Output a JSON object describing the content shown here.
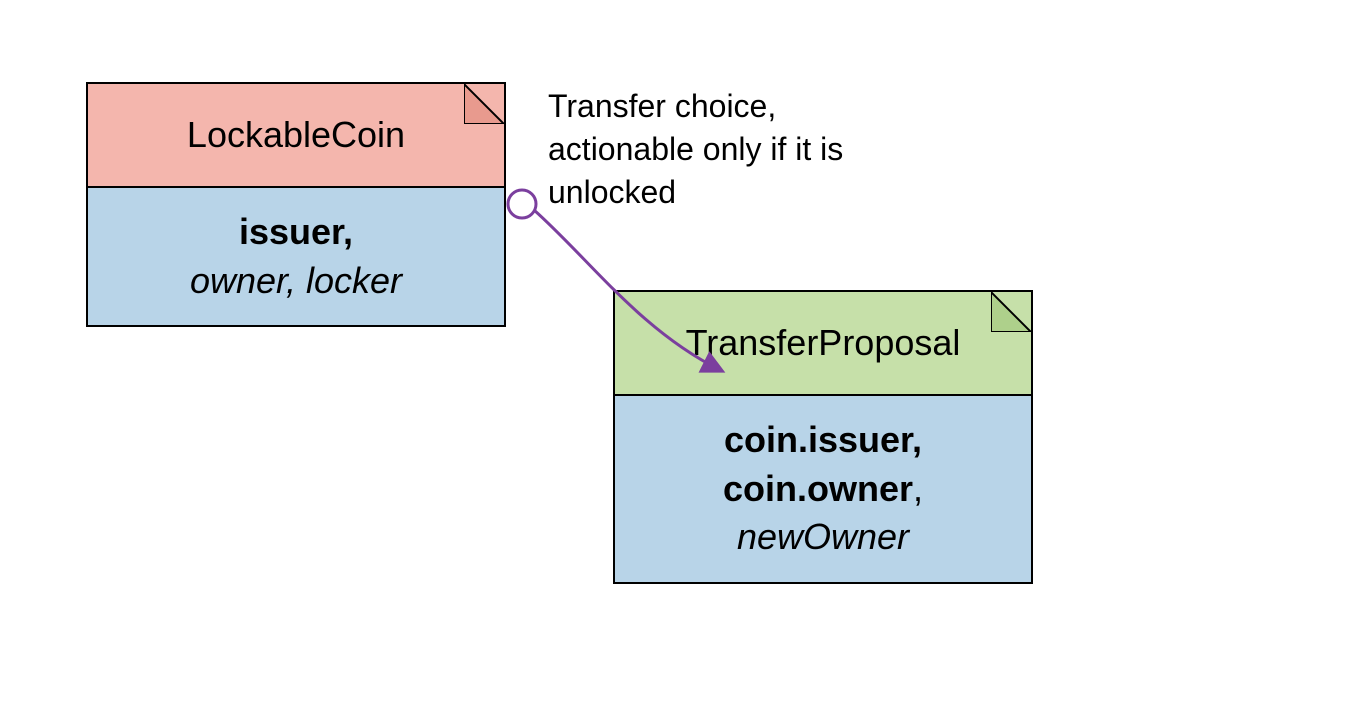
{
  "colors": {
    "pink": "#f4b6ad",
    "pinkDark": "#e89a8e",
    "blue": "#b8d4e8",
    "green": "#c6e0a9",
    "greenDark": "#aed08b",
    "arrow": "#7b3f9e"
  },
  "box1": {
    "title": "LockableCoin",
    "bodyBold": "issuer,",
    "bodyItalic": "owner, locker"
  },
  "box2": {
    "title": "TransferProposal",
    "bodyBold1": "coin.issuer,",
    "bodyBold2": "coin.owner",
    "bodyComma": ",",
    "bodyItalic": "newOwner"
  },
  "label": {
    "line1": "Transfer choice,",
    "line2": "actionable only if it is",
    "line3": "unlocked"
  }
}
